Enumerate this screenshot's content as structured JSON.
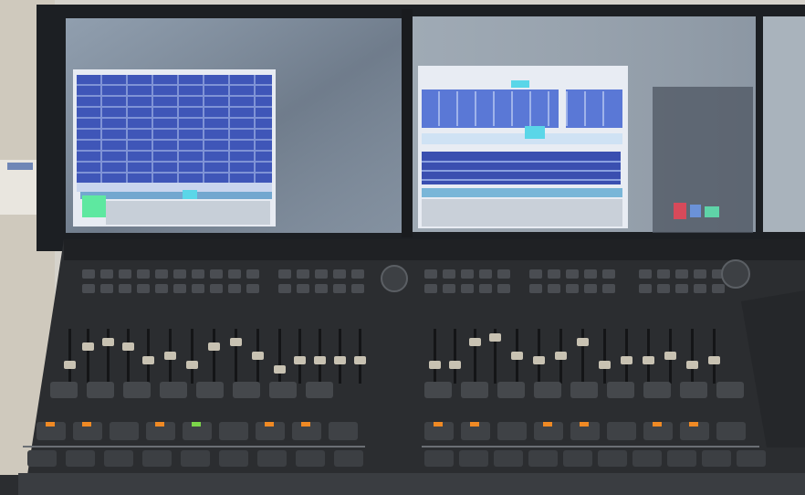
{
  "scene": {
    "subject": "lighting-console",
    "screens": [
      {
        "name": "left-monitor",
        "window_color": "#3f56b8"
      },
      {
        "name": "center-monitor",
        "window_color": "#5a78d6"
      },
      {
        "name": "right-monitor",
        "window_color": "#9fb6d0"
      }
    ],
    "colors": {
      "monitor_bezel": "#1c1f23",
      "console_body": "#2b2d30",
      "fader_cap": "#c8c2b2",
      "led_orange": "#f08a24",
      "led_green": "#7cd64a",
      "screen_highlight": "#5ad6e8"
    },
    "icons": [
      "fader-icon",
      "button-icon",
      "encoder-knob-icon",
      "led-icon"
    ]
  }
}
